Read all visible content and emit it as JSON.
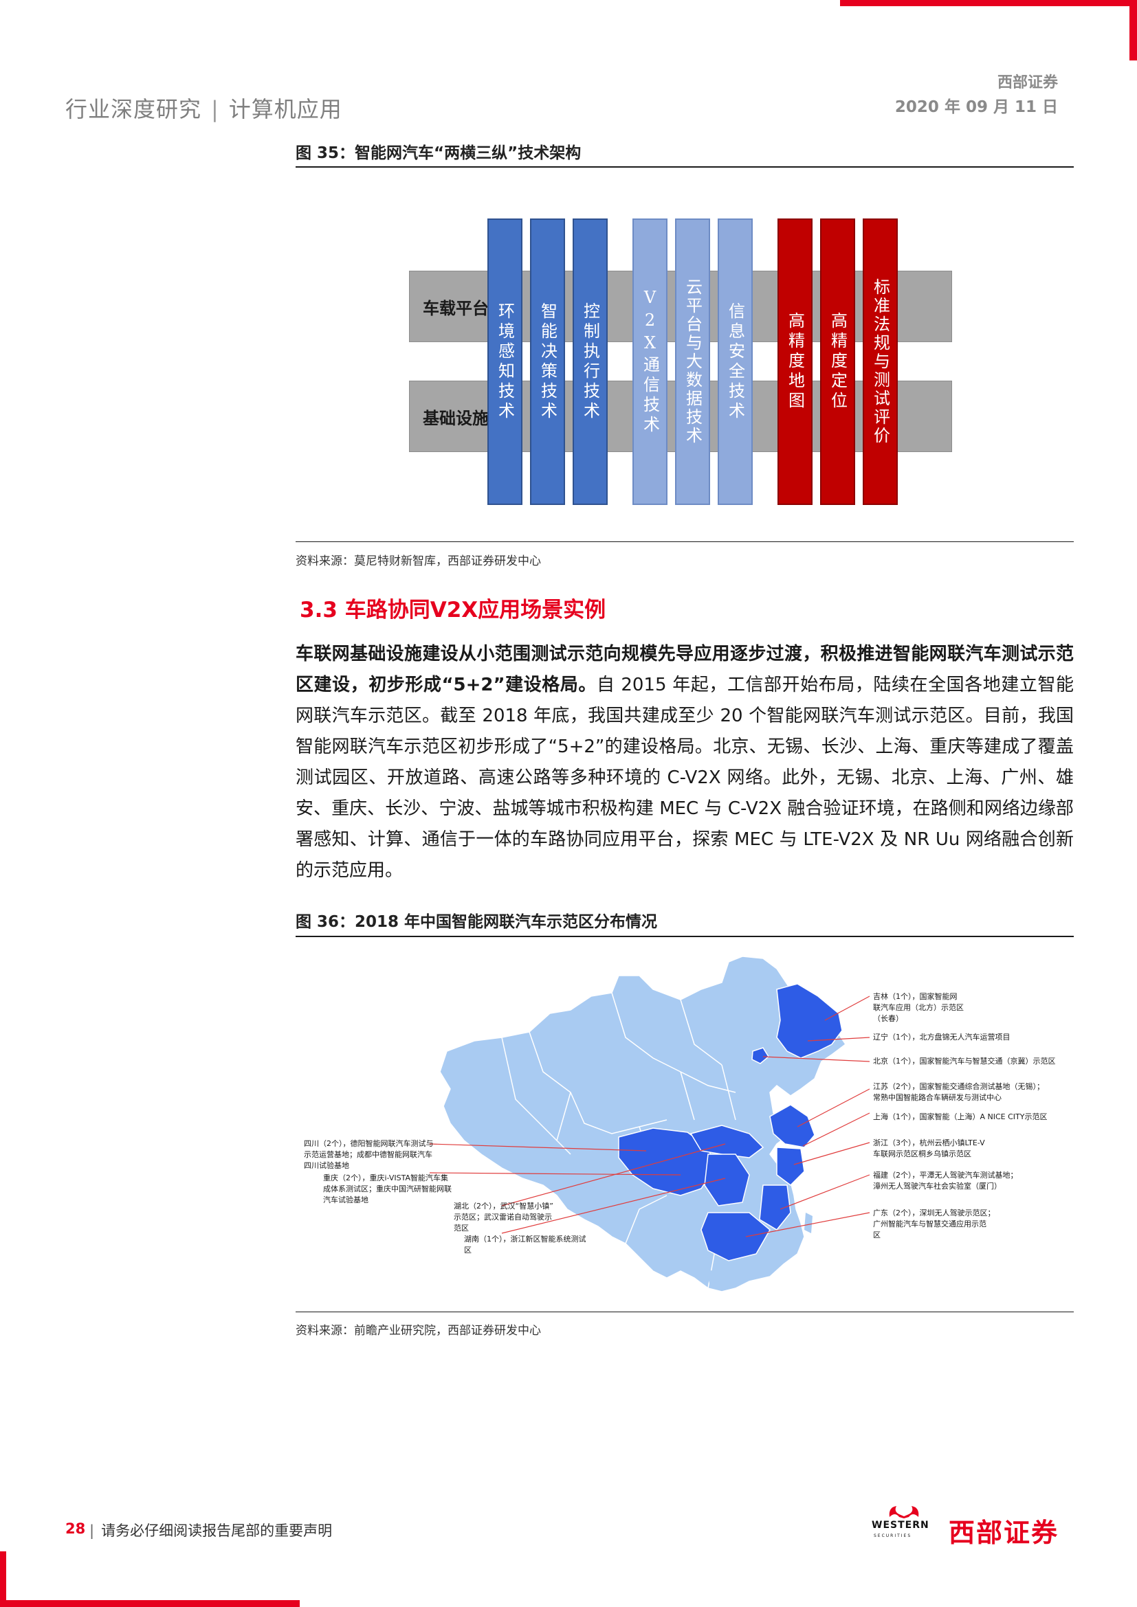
{
  "header": {
    "category": "行业深度研究",
    "subcategory": "计算机应用",
    "brand": "西部证券",
    "date": "2020 年 09 月 11 日"
  },
  "figure35": {
    "title": "图 35：智能网汽车“两横三纵”技术架构",
    "rows": [
      "车载平台",
      "基础设施"
    ],
    "columns": [
      {
        "text": "环境感知技术",
        "color": "blue"
      },
      {
        "text": "智能决策技术",
        "color": "blue"
      },
      {
        "text": "控制执行技术",
        "color": "blue"
      },
      {
        "text": "V2X通信技术",
        "color": "light"
      },
      {
        "text": "云平台与大数据技术",
        "color": "light"
      },
      {
        "text": "信息安全技术",
        "color": "light"
      },
      {
        "text": "高精度地图",
        "color": "red"
      },
      {
        "text": "高精度定位",
        "color": "red"
      },
      {
        "text": "标准法规与测试评价",
        "color": "red"
      }
    ],
    "source": "资料来源：莫尼特财新智库，西部证券研发中心"
  },
  "section": {
    "title": "3.3  车路协同V2X应用场景实例"
  },
  "paragraph": {
    "bold": "车联网基础设施建设从小范围测试示范向规模先导应用逐步过渡，积极推进智能网联汽车测试示范区建设，初步形成“5+2”建设格局。",
    "text": "自 2015 年起，工信部开始布局，陆续在全国各地建立智能网联汽车示范区。截至 2018 年底，我国共建成至少 20 个智能网联汽车测试示范区。目前，我国智能网联汽车示范区初步形成了“5+2”的建设格局。北京、无锡、长沙、上海、重庆等建成了覆盖测试园区、开放道路、高速公路等多种环境的 C-V2X 网络。此外，无锡、北京、上海、广州、雄安、重庆、长沙、宁波、盐城等城市积极构建 MEC 与 C-V2X 融合验证环境，在路侧和网络边缘部署感知、计算、通信于一体的车路协同应用平台，探索 MEC 与 LTE-V2X 及 NR Uu 网络融合创新的示范应用。"
  },
  "figure36": {
    "title": "图 36：2018 年中国智能网联汽车示范区分布情况",
    "labels_right": [
      [
        "吉林（1个），国家智能网",
        "联汽车应用（北方）示范区",
        "（长春）"
      ],
      [
        "辽宁（1个），北方盘锦无人汽车运营项目"
      ],
      [
        "北京（1个），国家智能汽车与智慧交通（京冀）示范区"
      ],
      [
        "江苏（2个），国家智能交通综合测试基地（无锡）；",
        "常熟中国智能路合车辆研发与测试中心"
      ],
      [
        "上海（1个），国家智能（上海）A NICE CITY示范区"
      ],
      [
        "浙江（3个），杭州云栖小镇LTE-V",
        "车联网示范区桐乡乌镇示范区"
      ],
      [
        "福建（2个），平潭无人驾驶汽车测试基地；",
        "漳州无人驾驶汽车社会实验室（厦门）"
      ],
      [
        "广东（2个），深圳无人驾驶示范区；",
        "广州智能汽车与智慧交通应用示范",
        "区"
      ]
    ],
    "labels_left": [
      [
        "四川（2个），德阳智能网联汽车测试与",
        "示范运营基地；成都中德智能网联汽车",
        "四川试验基地"
      ],
      [
        "重庆（2个），重庆i-VISTA智能汽车集",
        "成体系测试区；重庆中国汽研智能网联",
        "汽车试验基地"
      ],
      [
        "湖北（2个），武汉“智慧小镇”",
        "示范区；武汉雷诺自动驾驶示",
        "范区"
      ],
      [
        "湖南（1个），浙江新区智能系统测试",
        "区"
      ]
    ],
    "source": "资料来源：前瞻产业研究院，西部证券研发中心"
  },
  "footer": {
    "page": "28",
    "text": "请务必仔细阅读报告尾部的重要声明",
    "logo_en": "WESTERN",
    "logo_en_sub": "SECURITIES",
    "logo_cn": "西部证券"
  },
  "colors": {
    "accent_red": "#e6001e",
    "col_blue": "#4472c4",
    "col_light": "#8faadc",
    "col_red": "#c00000",
    "map_light": "#a9cbf2",
    "map_highlight": "#2e5ce6"
  }
}
